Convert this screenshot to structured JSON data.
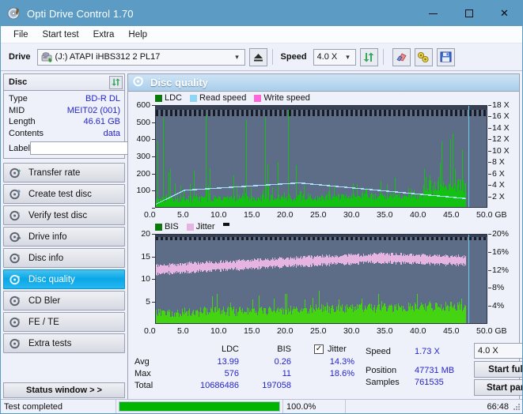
{
  "window": {
    "title": "Opti Drive Control 1.70",
    "icon": "disc-icon",
    "minimize": "minimize-icon",
    "maximize": "maximize-icon",
    "close": "close-icon",
    "titlebar_color": "#5b9bc4"
  },
  "menu": {
    "items": [
      "File",
      "Start test",
      "Extra",
      "Help"
    ]
  },
  "toolbar": {
    "drive_label": "Drive",
    "drive_value": "(J:)  ATAPI iHBS312  2 PL17",
    "eject_icon": "eject-icon",
    "speed_label": "Speed",
    "speed_value": "4.0 X",
    "refresh_icon": "refresh-icon",
    "eraser_icon": "eraser-icon",
    "tools_icon": "tools-icon",
    "save_icon": "save-icon"
  },
  "disc": {
    "header": "Disc",
    "refresh_icon": "refresh-icon",
    "rows": [
      {
        "key": "Type",
        "value": "BD-R DL"
      },
      {
        "key": "MID",
        "value": "MEIT02 (001)"
      },
      {
        "key": "Length",
        "value": "46.61 GB"
      },
      {
        "key": "Contents",
        "value": "data"
      }
    ],
    "label_key": "Label",
    "label_value": "",
    "label_placeholder": "",
    "label_button_icon": "disc-icon"
  },
  "nav": {
    "items": [
      {
        "label": "Transfer rate",
        "icon": "disc-rate-icon",
        "active": false
      },
      {
        "label": "Create test disc",
        "icon": "disc-burn-icon",
        "active": false
      },
      {
        "label": "Verify test disc",
        "icon": "disc-verify-icon",
        "active": false
      },
      {
        "label": "Drive info",
        "icon": "disc-drive-icon",
        "active": false
      },
      {
        "label": "Disc info",
        "icon": "disc-info-icon",
        "active": false
      },
      {
        "label": "Disc quality",
        "icon": "disc-quality-icon",
        "active": true
      },
      {
        "label": "CD Bler",
        "icon": "disc-bler-icon",
        "active": false
      },
      {
        "label": "FE / TE",
        "icon": "disc-fete-icon",
        "active": false
      },
      {
        "label": "Extra tests",
        "icon": "disc-extra-icon",
        "active": false
      }
    ],
    "status_window": "Status window > >"
  },
  "main": {
    "header": "Disc quality",
    "header_icon": "disc-quality-icon"
  },
  "chart_data": [
    {
      "type": "bar",
      "id": "top-chart",
      "title": "LDC / Read speed",
      "legend": [
        {
          "label": "LDC",
          "color": "#0b7a0b"
        },
        {
          "label": "Read speed",
          "color": "#8fd6f5"
        },
        {
          "label": "Write speed",
          "color": "#ff66d9"
        }
      ],
      "xlabel": "GB",
      "ylabel": "",
      "xlim": [
        0,
        50
      ],
      "xticks": [
        0.0,
        5.0,
        10.0,
        15.0,
        20.0,
        25.0,
        30.0,
        35.0,
        40.0,
        45.0,
        50.0
      ],
      "xticklabels": [
        "0.0",
        "5.0",
        "10.0",
        "15.0",
        "20.0",
        "25.0",
        "30.0",
        "35.0",
        "40.0",
        "45.0",
        "50.0 GB"
      ],
      "ylim": [
        0,
        600
      ],
      "yticks": [
        0,
        100,
        200,
        300,
        400,
        500,
        600
      ],
      "yticklabels": [
        "",
        "100",
        "200",
        "300",
        "400",
        "500",
        "600"
      ],
      "y2lim": [
        0,
        18
      ],
      "y2ticks": [
        2,
        4,
        6,
        8,
        10,
        12,
        14,
        16,
        18
      ],
      "y2ticklabels": [
        "2 X",
        "4 X",
        "6 X",
        "8 X",
        "10 X",
        "12 X",
        "14 X",
        "16 X",
        "18 X"
      ],
      "grid": true,
      "data_end_gb": 46.61,
      "cursor_gb": 47.0,
      "series": [
        {
          "name": "LDC",
          "color": "#12c112",
          "avg": 13.99,
          "max": 576,
          "total": 10686486
        },
        {
          "name": "Read speed",
          "color": "#a9def8",
          "start_x": 4.4,
          "end_x": 46.6,
          "start_y": 1.0,
          "peak_y": 4.5,
          "end_y": 1.9
        }
      ]
    },
    {
      "type": "bar",
      "id": "bottom-chart",
      "title": "BIS / Jitter",
      "legend": [
        {
          "label": "BIS",
          "color": "#0b7a0b"
        },
        {
          "label": "Jitter",
          "color": "#e6b4e0"
        }
      ],
      "xlabel": "GB",
      "xlim": [
        0,
        50
      ],
      "xticks": [
        0.0,
        5.0,
        10.0,
        15.0,
        20.0,
        25.0,
        30.0,
        35.0,
        40.0,
        45.0,
        50.0
      ],
      "xticklabels": [
        "0.0",
        "5.0",
        "10.0",
        "15.0",
        "20.0",
        "25.0",
        "30.0",
        "35.0",
        "40.0",
        "45.0",
        "50.0 GB"
      ],
      "ylim": [
        0,
        20
      ],
      "yticks": [
        5,
        10,
        15,
        20
      ],
      "yticklabels": [
        "5",
        "10",
        "15",
        "20"
      ],
      "y2lim": [
        0,
        20
      ],
      "y2ticks": [
        4,
        8,
        12,
        16,
        20
      ],
      "y2ticklabels": [
        "4%",
        "8%",
        "12%",
        "16%",
        "20%"
      ],
      "grid": true,
      "data_end_gb": 46.61,
      "cursor_gb": 47.0,
      "series": [
        {
          "name": "BIS",
          "color": "#44d411",
          "avg": 0.26,
          "max": 11,
          "total": 197058
        },
        {
          "name": "Jitter",
          "color": "#e6b4e0",
          "avg_pct": 14.3,
          "max_pct": 18.6
        }
      ]
    }
  ],
  "stats": {
    "col_ldc": "LDC",
    "col_bis": "BIS",
    "row_avg": "Avg",
    "row_max": "Max",
    "row_total": "Total",
    "avg_ldc": "13.99",
    "avg_bis": "0.26",
    "max_ldc": "576",
    "max_bis": "11",
    "total_ldc": "10686486",
    "total_bis": "197058",
    "jitter_label": "Jitter",
    "jitter_checked": "✓",
    "jitter_avg": "14.3%",
    "jitter_max": "18.6%",
    "speed_label": "Speed",
    "speed_value": "1.73 X",
    "position_label": "Position",
    "position_value": "47731 MB",
    "samples_label": "Samples",
    "samples_value": "761535",
    "speed_select": "4.0 X",
    "start_full": "Start full",
    "start_part": "Start part"
  },
  "statusbar": {
    "message": "Test completed",
    "progress_percent": "100.0%",
    "progress_value": 100,
    "elapsed": "66:48",
    "grip": "resize-grip-icon"
  }
}
